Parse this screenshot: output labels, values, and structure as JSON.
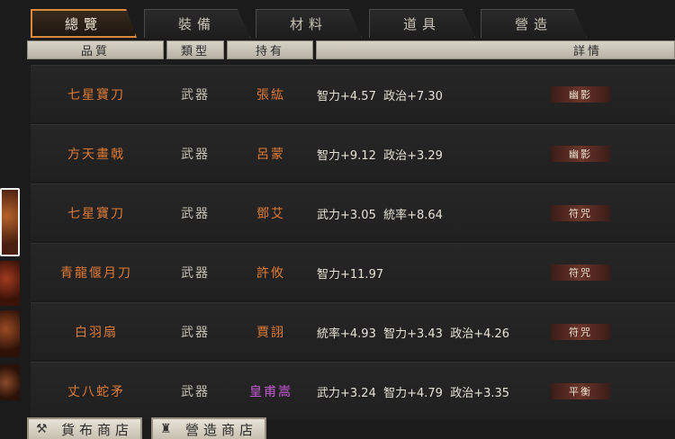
{
  "tabs": [
    "總覽",
    "裝備",
    "材料",
    "道具",
    "營造"
  ],
  "columns": [
    "品質",
    "類型",
    "持有",
    "詳情"
  ],
  "rows": [
    {
      "name": "七星寶刀",
      "type": "武器",
      "holder": "張紘",
      "detail": "智力+4.57  政治+7.30",
      "skill": "幽影"
    },
    {
      "name": "方天畫戟",
      "type": "武器",
      "holder": "呂蒙",
      "detail": "智力+9.12  政治+3.29",
      "skill": "幽影"
    },
    {
      "name": "七星寶刀",
      "type": "武器",
      "holder": "鄧艾",
      "detail": "武力+3.05  統率+8.64",
      "skill": "符咒"
    },
    {
      "name": "青龍偃月刀",
      "type": "武器",
      "holder": "許攸",
      "detail": "智力+11.97",
      "skill": "符咒"
    },
    {
      "name": "白羽扇",
      "type": "武器",
      "holder": "賈詡",
      "detail": "統率+4.93  智力+3.43  政治+4.26",
      "skill": "符咒"
    },
    {
      "name": "丈八蛇矛",
      "type": "武器",
      "holder": "皇甫嵩",
      "detail": "武力+3.24  智力+4.79  政治+3.35",
      "skill": "平衡"
    }
  ],
  "buttons": {
    "shop": "貨布商店",
    "build_shop": "營造商店"
  },
  "icons": {
    "shop": "hammer-icon",
    "build_shop": "tower-icon"
  },
  "colors": {
    "accent": "#d98a3c",
    "quality_orange": "#e07b34",
    "holder_purple": "#c65ad8"
  }
}
